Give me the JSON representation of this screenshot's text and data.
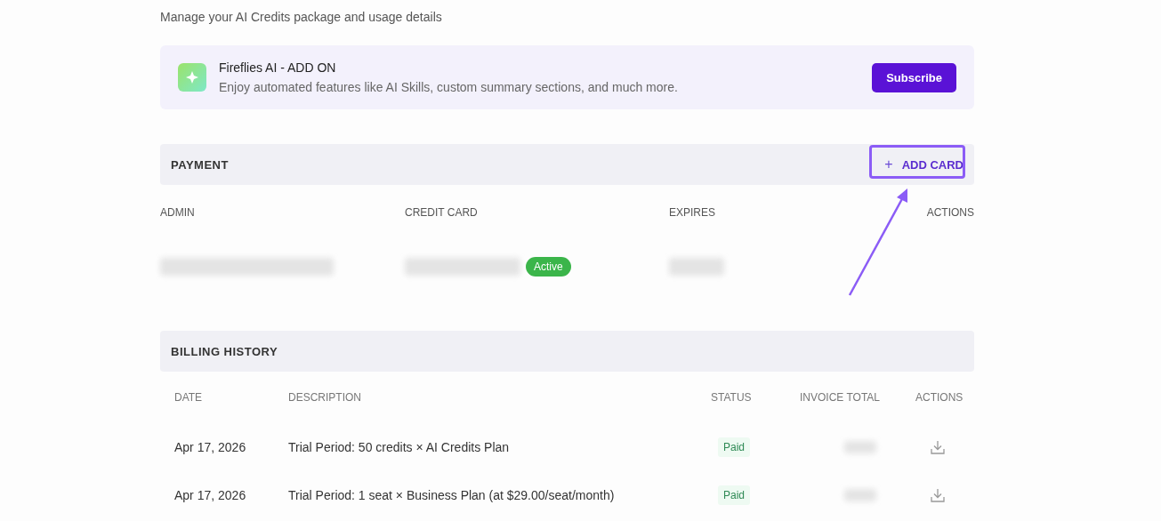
{
  "subtitle": "Manage your AI Credits package and usage details",
  "addon": {
    "title": "Fireflies AI - ADD ON",
    "description": "Enjoy automated features like AI Skills, custom summary sections, and much more.",
    "button": "Subscribe"
  },
  "payment": {
    "title": "PAYMENT",
    "add_button": {
      "label": "ADD CARD",
      "icon": "+",
      "highlighted": true
    },
    "columns": [
      "ADMIN",
      "CREDIT CARD",
      "EXPIRES",
      "ACTIONS"
    ],
    "rows": [
      {
        "status": "Active"
      }
    ]
  },
  "billing": {
    "title": "BILLING HISTORY",
    "columns": [
      "DATE",
      "DESCRIPTION",
      "STATUS",
      "INVOICE TOTAL",
      "ACTIONS"
    ],
    "rows": [
      {
        "date": "Apr 17, 2026",
        "description": "Trial Period: 50 credits × AI Credits Plan",
        "status": "Paid"
      },
      {
        "date": "Apr 17, 2026",
        "description": "Trial Period: 1 seat × Business Plan (at $29.00/seat/month)",
        "status": "Paid"
      }
    ]
  }
}
